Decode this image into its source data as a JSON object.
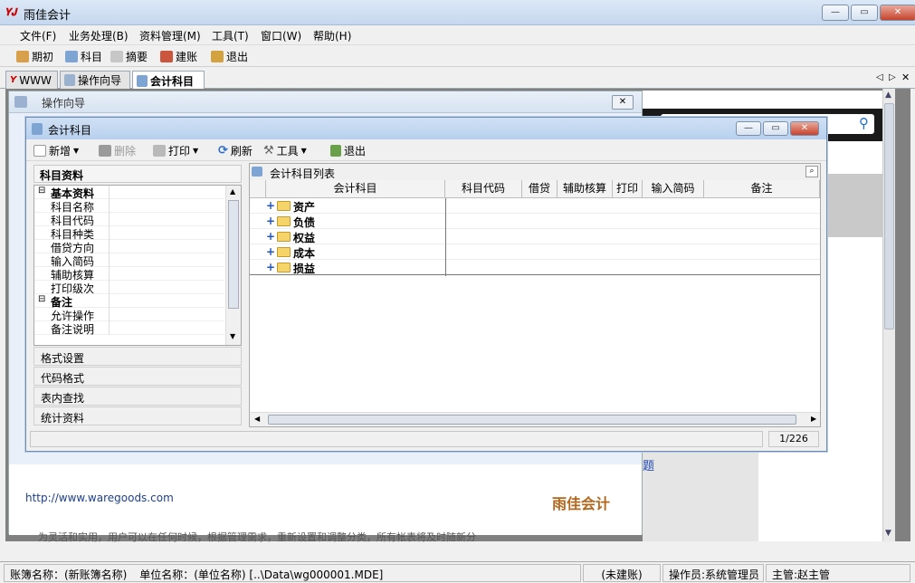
{
  "app": {
    "title": "雨佳会计"
  },
  "menu": [
    "文件(F)",
    "业务处理(B)",
    "资料管理(M)",
    "工具(T)",
    "窗口(W)",
    "帮助(H)"
  ],
  "toolbar": [
    "期初",
    "科目",
    "摘要",
    "建账",
    "退出"
  ],
  "tabs": [
    "WWW",
    "操作向导",
    "会计科目"
  ],
  "wizard": {
    "title": "操作向导",
    "url": "http://www.waregoods.com",
    "brand": "雨佳会计",
    "bottom_text": "为灵活和实用，用户可以在任何时候，根据管理需求，重新设置和调整分类，所有帐表将及时随新分",
    "link_fragment": "题"
  },
  "accounts": {
    "title": "会计科目",
    "toolbar": [
      "新增",
      "删除",
      "打印",
      "刷新",
      "工具",
      "退出"
    ],
    "left_header": "科目资料",
    "tree": [
      {
        "label": "基本资料",
        "group": true
      },
      {
        "label": "科目名称"
      },
      {
        "label": "科目代码"
      },
      {
        "label": "科目种类"
      },
      {
        "label": "借贷方向"
      },
      {
        "label": "输入简码"
      },
      {
        "label": "辅助核算"
      },
      {
        "label": "打印级次"
      },
      {
        "label": "备注",
        "group": true
      },
      {
        "label": "允许操作"
      },
      {
        "label": "备注说明"
      }
    ],
    "sections": [
      "格式设置",
      "代码格式",
      "表内查找",
      "统计资料"
    ],
    "list_caption": "会计科目列表",
    "columns": [
      "会计科目",
      "科目代码",
      "借贷",
      "辅助核算",
      "打印",
      "输入简码",
      "备注"
    ],
    "rows": [
      "资产",
      "负债",
      "权益",
      "成本",
      "损益"
    ],
    "page_indicator": "1/226"
  },
  "statusbar": {
    "book": "账簿名称：(新账簿名称)",
    "unit": "单位名称：(单位名称) [..\\Data\\wg000001.MDE]",
    "state": "(未建账)",
    "operator": "操作员:系统管理员",
    "supervisor": "主管:赵主管"
  }
}
